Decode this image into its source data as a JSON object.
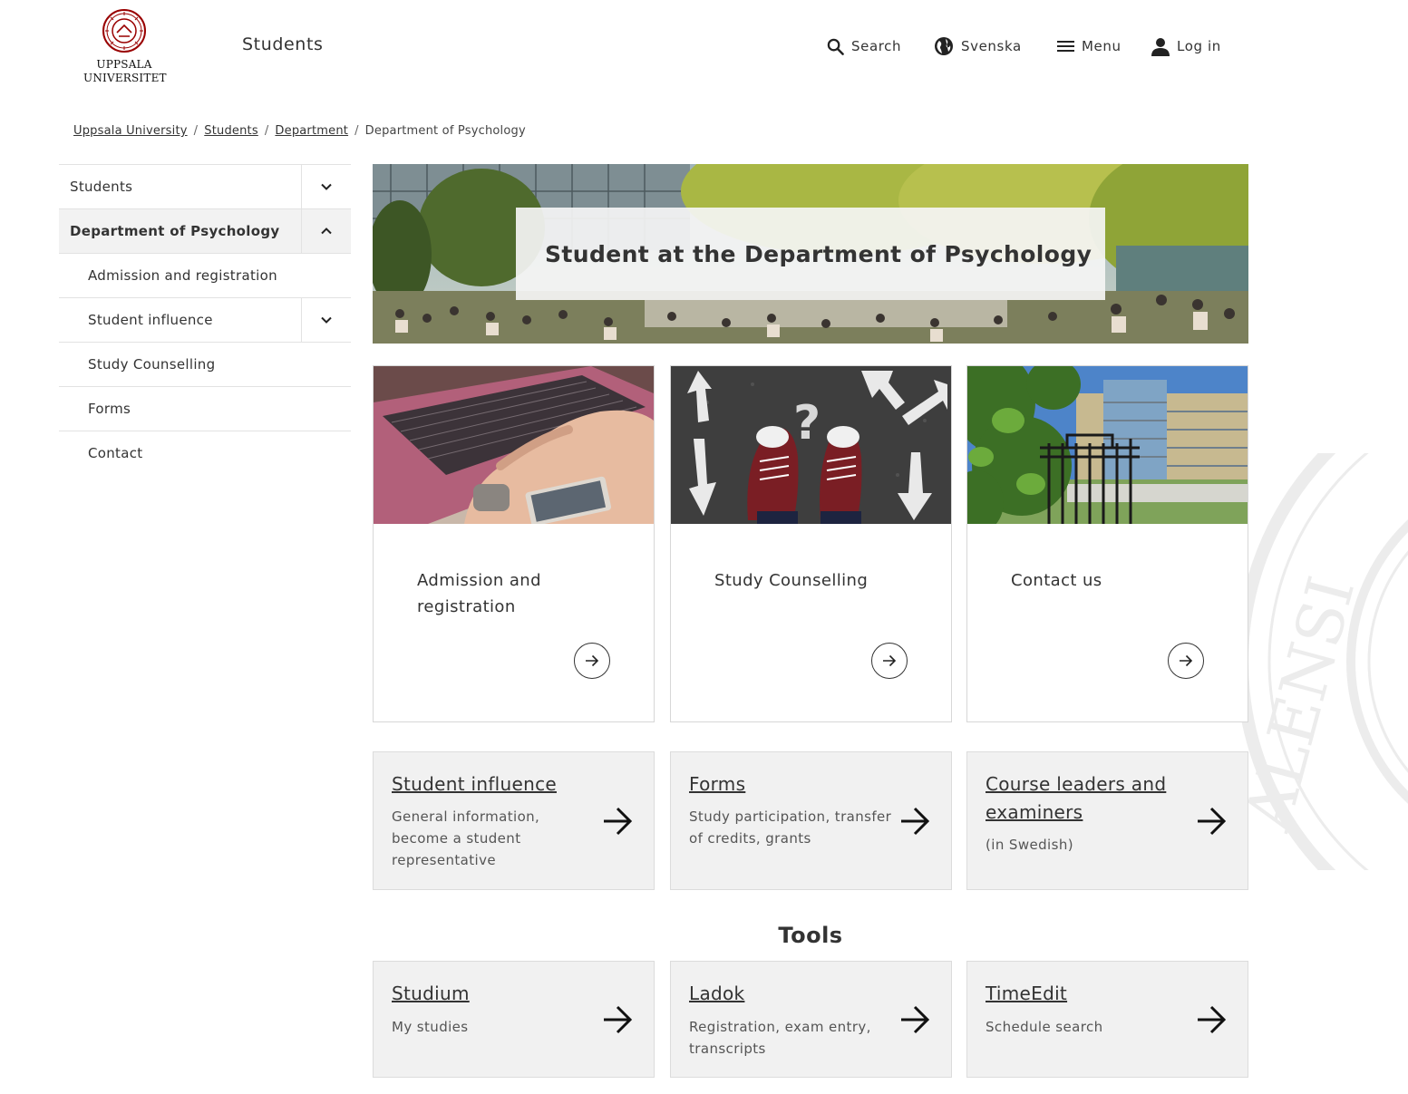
{
  "header": {
    "logo_line1": "UPPSALA",
    "logo_line2": "UNIVERSITET",
    "site_title": "Students",
    "nav": {
      "search": "Search",
      "language": "Svenska",
      "menu": "Menu",
      "login": "Log in"
    },
    "icons": [
      "search-icon",
      "globe-icon",
      "hamburger-icon",
      "user-icon"
    ]
  },
  "breadcrumb": [
    "Uppsala University",
    "Students",
    "Department",
    "Department of Psychology"
  ],
  "sidebar": {
    "items": [
      {
        "label": "Students",
        "toggle": "chevron-down"
      },
      {
        "label": "Department of Psychology",
        "toggle": "chevron-up",
        "active": true
      },
      {
        "label": "Admission and registration"
      },
      {
        "label": "Student influence",
        "toggle": "chevron-down"
      },
      {
        "label": "Study Counselling"
      },
      {
        "label": "Forms"
      },
      {
        "label": "Contact"
      }
    ]
  },
  "hero": {
    "title": "Student at the Department of Psychology"
  },
  "cards": [
    {
      "title": "Admission and registration"
    },
    {
      "title": "Study Counselling"
    },
    {
      "title": "Contact us"
    }
  ],
  "links": [
    {
      "title": "Student influence",
      "desc": "General information, become a student representative"
    },
    {
      "title": "Forms",
      "desc": "Study participation, transfer of credits, grants"
    },
    {
      "title": "Course leaders and examiners",
      "desc": "(in Swedish)"
    }
  ],
  "tools": {
    "heading": "Tools",
    "items": [
      {
        "title": "Studium",
        "desc": "My studies"
      },
      {
        "title": "Ladok",
        "desc": "Registration, exam entry, transcripts"
      },
      {
        "title": "TimeEdit",
        "desc": "Schedule search"
      }
    ]
  },
  "colors": {
    "brand_red": "#990000",
    "grey_box": "#f1f1f1",
    "text": "#333333"
  }
}
